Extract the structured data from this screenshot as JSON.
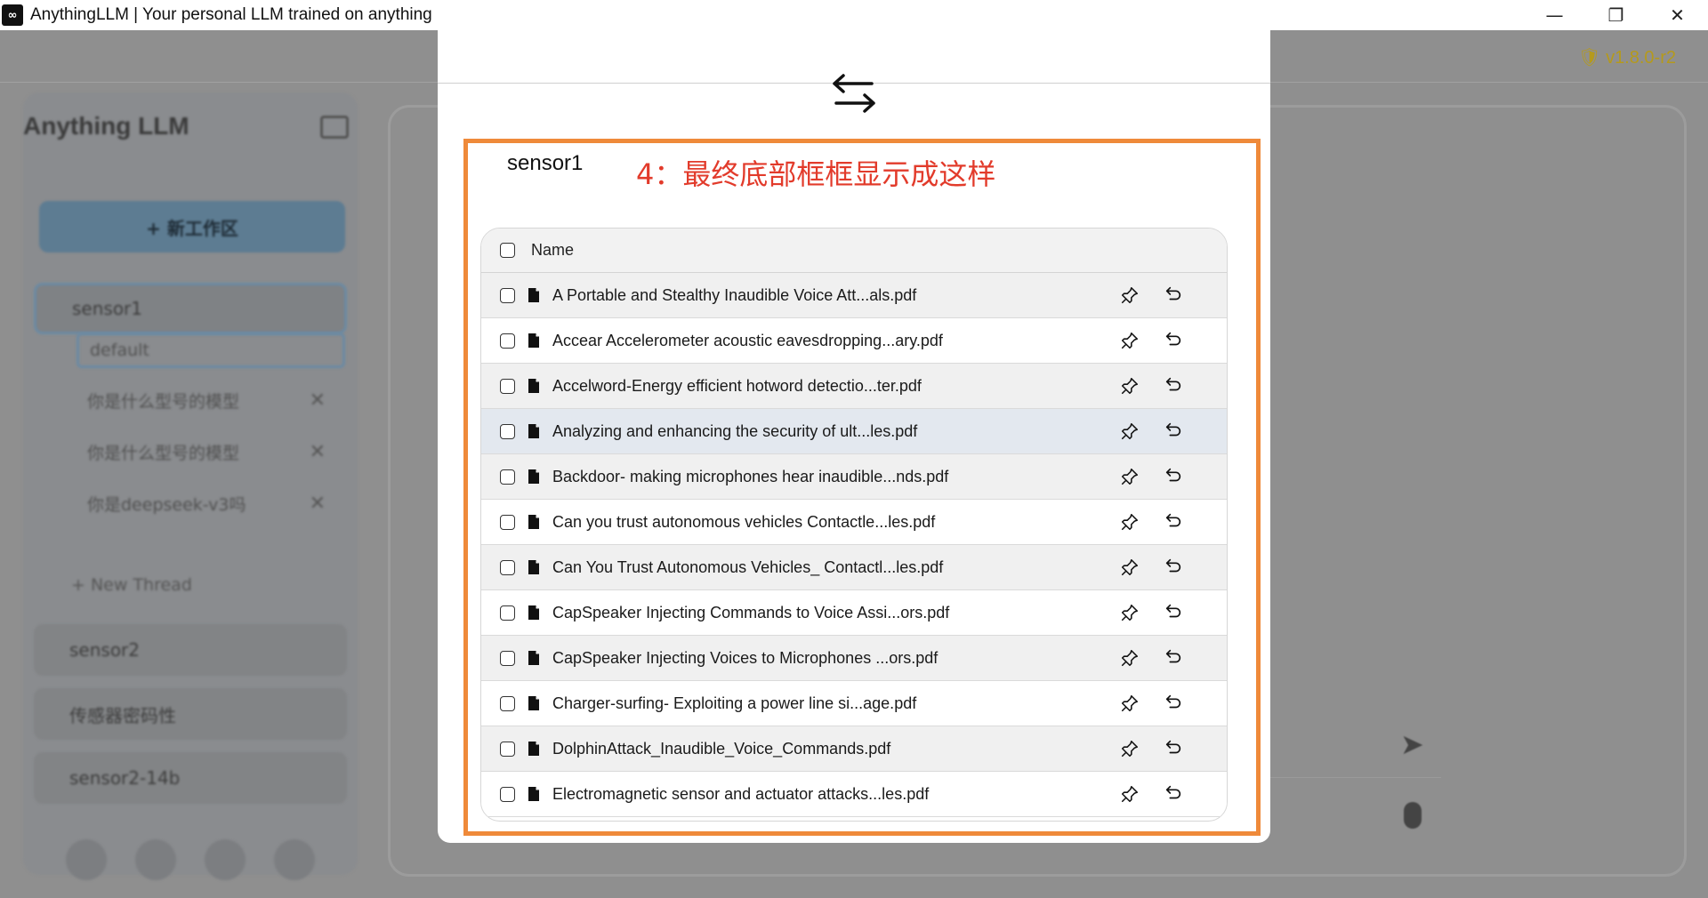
{
  "window": {
    "title": "AnythingLLM | Your personal LLM trained on anything",
    "icon_label": "∞",
    "controls": {
      "minimize": "—",
      "maximize": "❐",
      "close": "✕"
    }
  },
  "background": {
    "version": "v1.8.0-r2",
    "brand": "Anything LLM",
    "new_workspace_label": "+ 新工作区",
    "workspaces": [
      {
        "name": "sensor1"
      },
      {
        "name": "sensor2"
      },
      {
        "name": "传感器密码性"
      },
      {
        "name": "sensor2-14b"
      }
    ],
    "threads": [
      {
        "name": "default"
      },
      {
        "name": "你是什么型号的模型"
      },
      {
        "name": "你是什么型号的模型"
      },
      {
        "name": "你是deepseek-v3吗"
      }
    ],
    "new_thread_label": "+   New Thread"
  },
  "modal": {
    "workspace_name": "sensor1",
    "annotation": "4：最终底部框框显示成这样",
    "table_header": "Name",
    "files": [
      "A Portable and Stealthy Inaudible Voice Att...als.pdf",
      "Accear Accelerometer acoustic eavesdropping...ary.pdf",
      "Accelword-Energy efficient hotword detectio...ter.pdf",
      "Analyzing and enhancing the security of ult...les.pdf",
      "Backdoor- making microphones hear inaudible...nds.pdf",
      "Can you trust autonomous vehicles Contactle...les.pdf",
      "Can You Trust Autonomous Vehicles_ Contactl...les.pdf",
      "CapSpeaker Injecting Commands to Voice Assi...ors.pdf",
      "CapSpeaker Injecting Voices to Microphones ...ors.pdf",
      "Charger-surfing- Exploiting a power line si...age.pdf",
      "DolphinAttack_Inaudible_Voice_Commands.pdf",
      "Electromagnetic sensor and actuator attacks...les.pdf"
    ]
  },
  "colors": {
    "highlight_border": "#ef8a3a",
    "annotation_text": "#e23b2b",
    "version_text": "#b59a1c",
    "overlay": "#8f8f8f"
  }
}
